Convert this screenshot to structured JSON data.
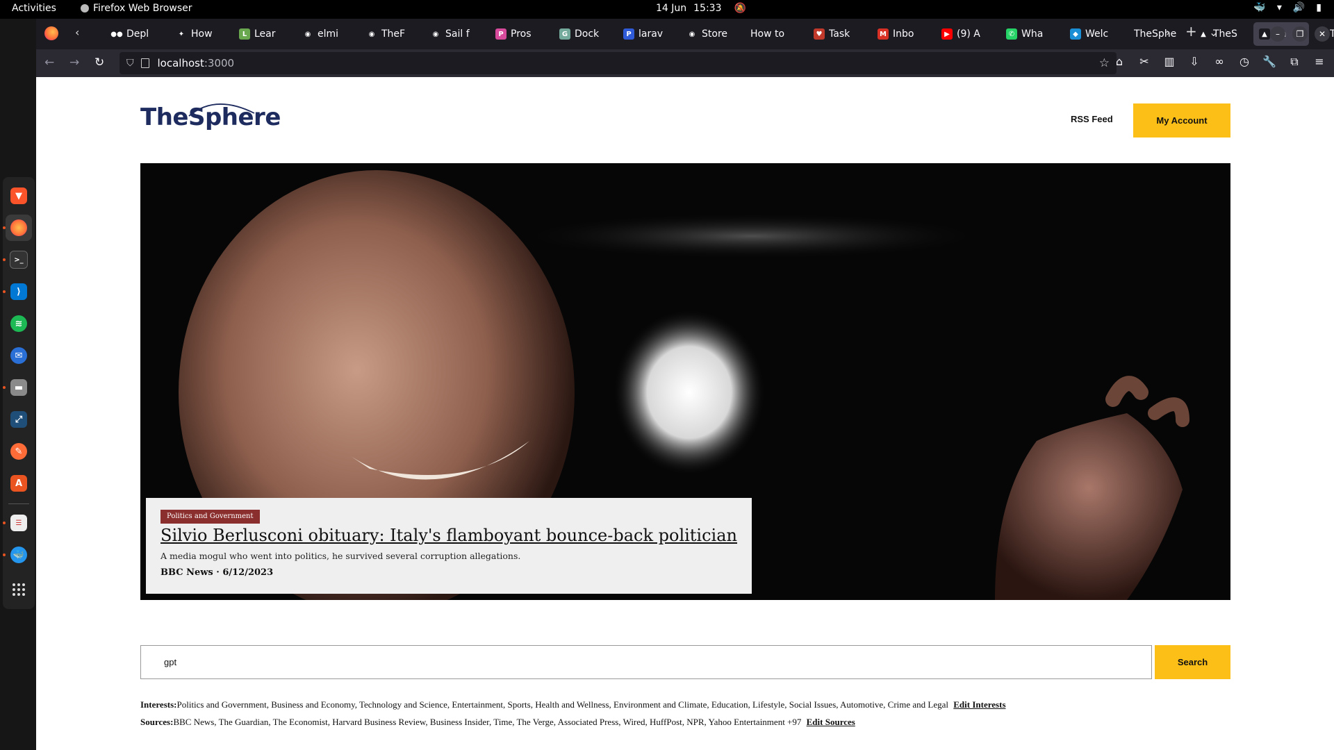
{
  "system": {
    "activities": "Activities",
    "app_name": "Firefox Web Browser",
    "date": "14 Jun",
    "time": "15:33"
  },
  "browser": {
    "tabs": [
      {
        "label": "Depl",
        "fav": "●●",
        "color": "#1c1b22"
      },
      {
        "label": "How",
        "fav": "✦",
        "color": "#1c1b22"
      },
      {
        "label": "Lear",
        "fav": "L",
        "color": "#6aa84f"
      },
      {
        "label": "elmi",
        "fav": "◉",
        "color": "#1c1b22"
      },
      {
        "label": "TheF",
        "fav": "◉",
        "color": "#1c1b22"
      },
      {
        "label": "Sail f",
        "fav": "◉",
        "color": "#1c1b22"
      },
      {
        "label": "Pros",
        "fav": "P",
        "color": "#d84a9b"
      },
      {
        "label": "Dock",
        "fav": "G",
        "color": "#74aa9c"
      },
      {
        "label": "larav",
        "fav": "P",
        "color": "#2f5bd8"
      },
      {
        "label": "Store",
        "fav": "◉",
        "color": "#1c1b22"
      },
      {
        "label": "How to",
        "fav": "",
        "color": "#1c1b22"
      },
      {
        "label": "Task",
        "fav": "♥",
        "color": "#c0392b"
      },
      {
        "label": "Inbo",
        "fav": "M",
        "color": "#d93025"
      },
      {
        "label": "(9) A",
        "fav": "▶",
        "color": "#ff0000"
      },
      {
        "label": "Wha",
        "fav": "✆",
        "color": "#25d366"
      },
      {
        "label": "Welc",
        "fav": "◆",
        "color": "#1a8fd6"
      },
      {
        "label": "TheSphe",
        "fav": "",
        "color": "#1c1b22"
      },
      {
        "label": "TheS",
        "fav": "▲",
        "color": "#1c1b22"
      },
      {
        "label": "Th",
        "fav": "▲",
        "color": "#1c1b22"
      },
      {
        "label": "TheS",
        "fav": "▲",
        "color": "#1c1b22"
      }
    ],
    "url_host": "localhost",
    "url_port": ":3000"
  },
  "site": {
    "logo": "TheSphere",
    "rss": "RSS Feed",
    "account": "My Account"
  },
  "hero": {
    "category": "Politics and Government",
    "title": "Silvio Berlusconi obituary: Italy's flamboyant bounce-back politician",
    "summary": "A media mogul who went into politics, he survived several corruption allegations.",
    "meta": "BBC News · 6/12/2023"
  },
  "search": {
    "value": "gpt",
    "button": "Search"
  },
  "interests": {
    "label": "Interests:",
    "text": "Politics and Government, Business and Economy, Technology and Science, Entertainment, Sports, Health and Wellness, Environment and Climate, Education, Lifestyle, Social Issues, Automotive, Crime and Legal",
    "edit": "Edit Interests"
  },
  "sources": {
    "label": "Sources:",
    "text": "BBC News, The Guardian, The Economist, Harvard Business Review, Business Insider, Time, The Verge, Associated Press, Wired, HuffPost, NPR, Yahoo Entertainment +97",
    "edit": "Edit Sources"
  }
}
